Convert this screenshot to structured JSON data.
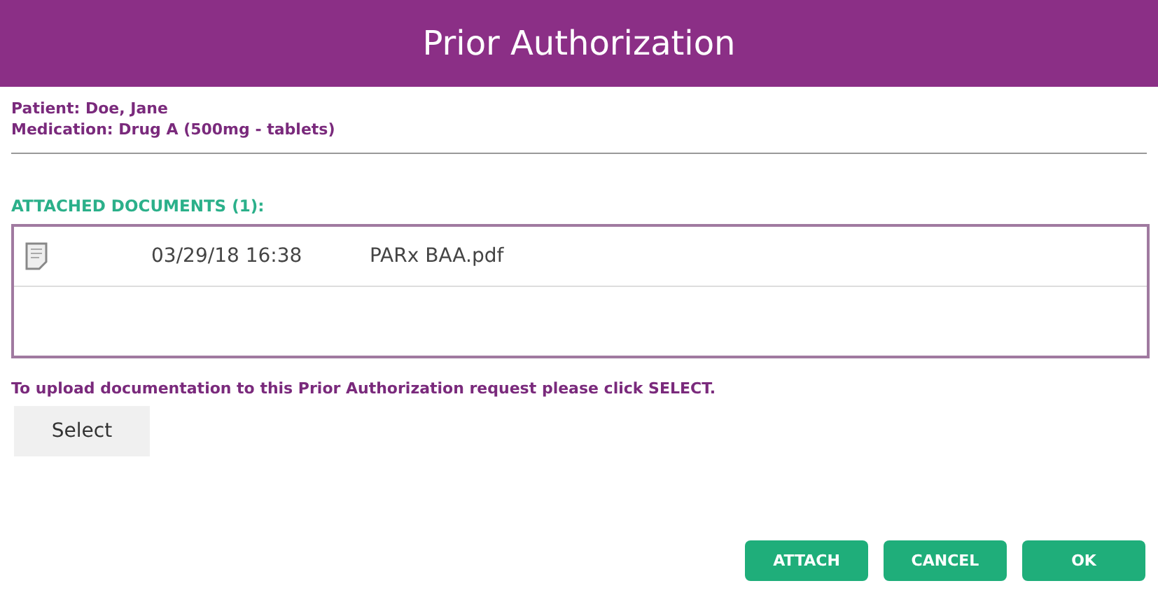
{
  "window": {
    "title": "Prior Authorization"
  },
  "patient": "Patient: Doe, Jane",
  "medication": "Medication: Drug A (500mg - tablets)",
  "attachments": {
    "heading": "ATTACHED DOCUMENTS (1):",
    "rows": [
      {
        "date": "03/29/18 16:38",
        "file": "PARx BAA.pdf"
      }
    ]
  },
  "upload_hint": "To upload documentation to this Prior Authorization request please click SELECT.",
  "select_button": "Select",
  "buttons": [
    "ATTACH",
    "CANCEL",
    "OK"
  ]
}
